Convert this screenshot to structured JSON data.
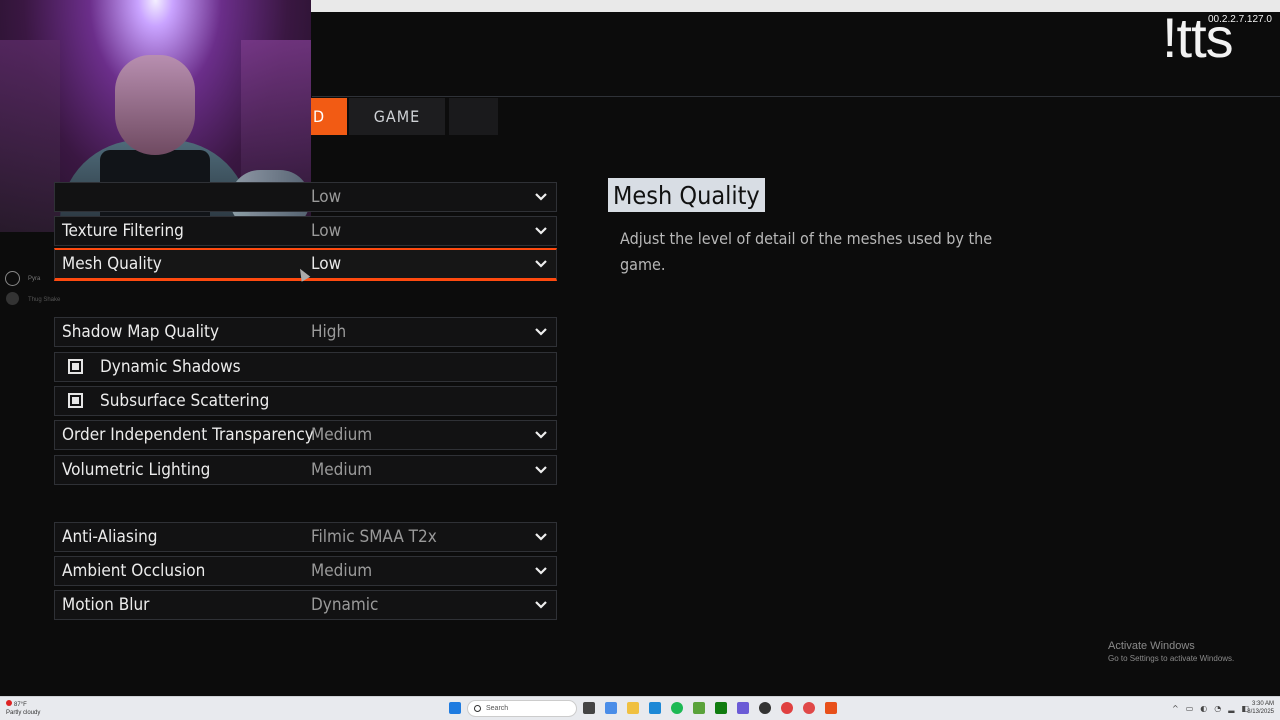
{
  "overlay": {
    "brand": "!tts",
    "version": "00.2.2.7.127.0"
  },
  "tabs": [
    {
      "label": "D",
      "active": true
    },
    {
      "label": "GAME",
      "active": false
    },
    {
      "label": "",
      "active": false
    }
  ],
  "settings": [
    {
      "label": "",
      "value": "Low",
      "type": "dropdown"
    },
    {
      "label": "Texture Filtering",
      "value": "Low",
      "type": "dropdown"
    },
    {
      "label": "Mesh Quality",
      "value": "Low",
      "type": "dropdown",
      "active": true
    },
    {
      "label": "Shadow Map Quality",
      "value": "High",
      "type": "dropdown"
    },
    {
      "label": "Dynamic Shadows",
      "checked": true,
      "type": "checkbox"
    },
    {
      "label": "Subsurface Scattering",
      "checked": true,
      "type": "checkbox"
    },
    {
      "label": "Order Independent Transparency",
      "value": "Medium",
      "type": "dropdown"
    },
    {
      "label": "Volumetric Lighting",
      "value": "Medium",
      "type": "dropdown"
    },
    {
      "label": "Anti-Aliasing",
      "value": "Filmic SMAA T2x",
      "type": "dropdown"
    },
    {
      "label": "Ambient Occlusion",
      "value": "Medium",
      "type": "dropdown"
    },
    {
      "label": "Motion Blur",
      "value": "Dynamic",
      "type": "dropdown"
    }
  ],
  "detail": {
    "title": "Mesh Quality",
    "description": "Adjust the level of detail of the meshes used by the game."
  },
  "chat": {
    "user1": "Pyra",
    "user2": "Thug Shake"
  },
  "activation": {
    "line1": "Activate Windows",
    "line2": "Go to Settings to activate Windows."
  },
  "taskbar": {
    "weather_temp": "87°F",
    "weather_desc": "Partly cloudy",
    "search_placeholder": "Search",
    "time": "3:30 AM",
    "date": "8/13/2025"
  },
  "colors": {
    "accent": "#ff4a0f",
    "tab_active": "#f25b14",
    "detail_title_bg": "#d8dde4"
  }
}
